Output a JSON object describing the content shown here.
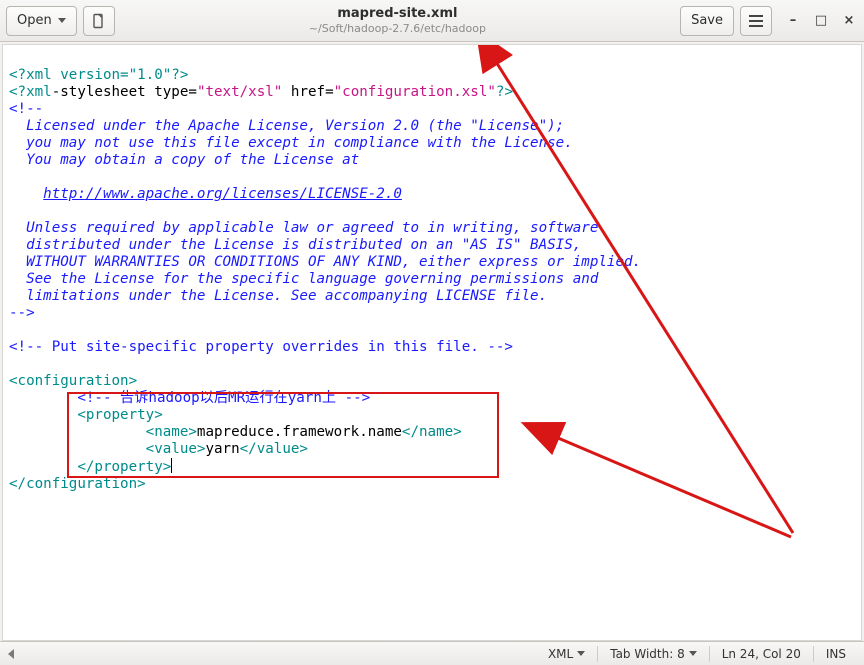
{
  "titlebar": {
    "open_label": "Open",
    "save_label": "Save",
    "filename": "mapred-site.xml",
    "filepath": "~/Soft/hadoop-2.7.6/etc/hadoop"
  },
  "statusbar": {
    "language": "XML",
    "tab_width_label": "Tab Width: 8",
    "cursor_pos": "Ln 24, Col 20",
    "insert_mode": "INS"
  },
  "code": {
    "l1_pi": "<?xml version=\"1.0\"?>",
    "l2_a": "<?xml",
    "l2_b": "-stylesheet type=",
    "l2_c": "\"text/xsl\"",
    "l2_d": " href=",
    "l2_e": "\"configuration.xsl\"",
    "l2_f": "?>",
    "l3": "<!--",
    "l4": "  Licensed under the Apache License, Version 2.0 (the \"License\");",
    "l5": "  you may not use this file except in compliance with the License.",
    "l6": "  You may obtain a copy of the License at",
    "l7": "",
    "l8_pad": "    ",
    "l8_url": "http://www.apache.org/licenses/LICENSE-2.0",
    "l9": "",
    "l10": "  Unless required by applicable law or agreed to in writing, software",
    "l11": "  distributed under the License is distributed on an \"AS IS\" BASIS,",
    "l12": "  WITHOUT WARRANTIES OR CONDITIONS OF ANY KIND, either express or implied.",
    "l13": "  See the License for the specific language governing permissions and",
    "l14": "  limitations under the License. See accompanying LICENSE file.",
    "l15": "-->",
    "l16": "",
    "l17": "<!-- Put site-specific property overrides in this file. -->",
    "l18": "",
    "l19": "<configuration>",
    "l20_pad": "        ",
    "l20_cmt": "<!-- 告诉hadoop以后MR运行在yarn上 -->",
    "l21_pad": "        ",
    "l21_tag": "<property>",
    "l22_pad": "                ",
    "l22_open": "<name>",
    "l22_txt": "mapreduce.framework.name",
    "l22_close": "</name>",
    "l23_pad": "                ",
    "l23_open": "<value>",
    "l23_txt": "yarn",
    "l23_close": "</value>",
    "l24_pad": "        ",
    "l24_tag": "</property>",
    "l25": "</configuration>"
  }
}
